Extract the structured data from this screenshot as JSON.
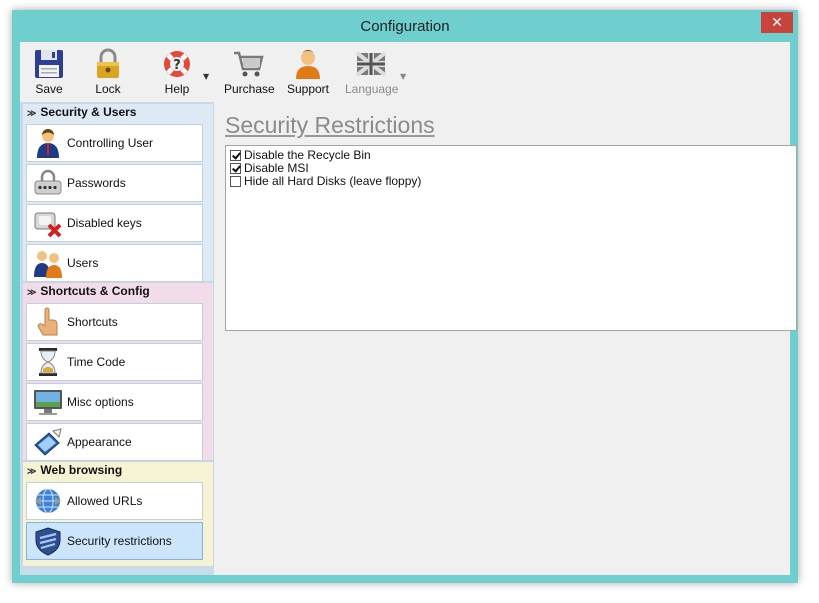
{
  "window": {
    "title": "Configuration",
    "close_glyph": "✕"
  },
  "toolbar": {
    "buttons": [
      {
        "label": "Save",
        "icon": "floppy-disk-icon"
      },
      {
        "label": "Lock",
        "icon": "padlock-icon"
      },
      {
        "label": "Help",
        "icon": "lifebuoy-help-icon"
      },
      {
        "label": "Purchase",
        "icon": "shopping-cart-icon"
      },
      {
        "label": "Support",
        "icon": "support-person-icon"
      },
      {
        "label": "Language",
        "icon": "uk-flag-icon",
        "disabled": true
      }
    ],
    "dropdown_glyph": "▼"
  },
  "sidebar": {
    "chevron_glyph": "≫",
    "groups": [
      {
        "title": "Security & Users",
        "color": "#dde9f5",
        "items": [
          {
            "label": "Controlling User",
            "icon": "user-icon"
          },
          {
            "label": "Passwords",
            "icon": "password-lock-icon"
          },
          {
            "label": "Disabled keys",
            "icon": "disabled-keys-icon"
          },
          {
            "label": "Users",
            "icon": "users-icon"
          }
        ]
      },
      {
        "title": "Shortcuts & Config",
        "color": "#f2dcea",
        "items": [
          {
            "label": "Shortcuts",
            "icon": "hand-pointer-icon"
          },
          {
            "label": "Time Code",
            "icon": "hourglass-icon"
          },
          {
            "label": "Misc options",
            "icon": "monitor-icon"
          },
          {
            "label": "Appearance",
            "icon": "appearance-icon"
          }
        ]
      },
      {
        "title": "Web browsing",
        "color": "#f6f2d4",
        "items": [
          {
            "label": "Allowed URLs",
            "icon": "globe-icon"
          },
          {
            "label": "Security restrictions",
            "icon": "shield-icon",
            "active": true
          }
        ]
      }
    ]
  },
  "main": {
    "heading": "Security Restrictions",
    "options": [
      {
        "label": "Disable the Recycle Bin",
        "checked": true
      },
      {
        "label": "Disable MSI",
        "checked": true
      },
      {
        "label": "Hide all Hard Disks (leave floppy)",
        "checked": false
      }
    ]
  }
}
